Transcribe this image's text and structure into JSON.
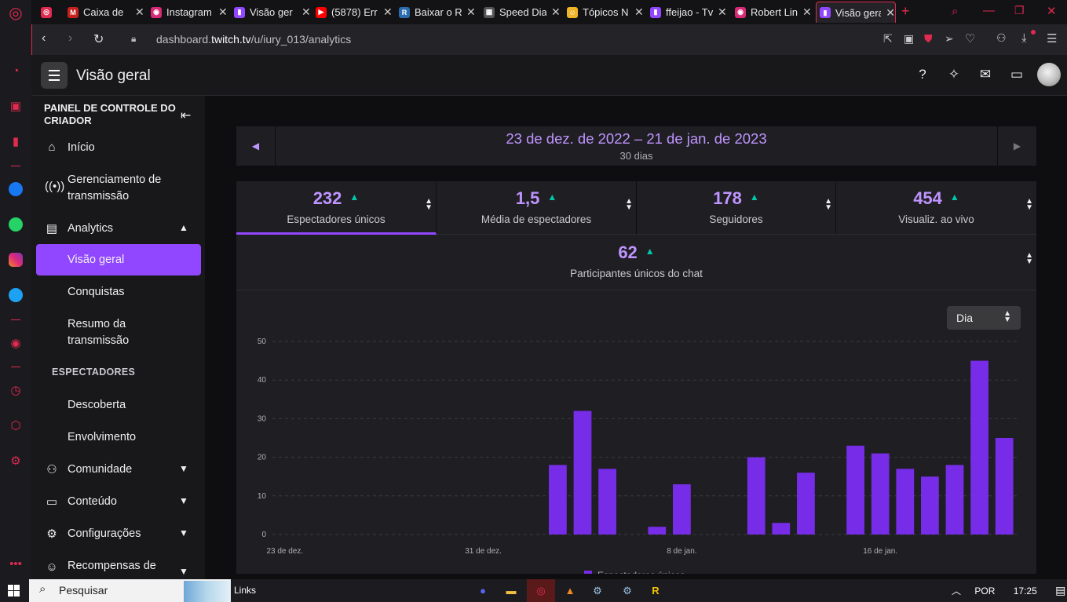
{
  "browser": {
    "tabs": [
      {
        "title": "",
        "fav_color": "#e02a4f",
        "fav_glyph": "◎",
        "x": 12,
        "w": 24
      },
      {
        "title": "Caixa de",
        "fav_color": "#c5221f",
        "fav_glyph": "M",
        "x": 46,
        "w": 100
      },
      {
        "title": "Instagram",
        "fav_color": "#d62976",
        "fav_glyph": "◉",
        "x": 152,
        "w": 100
      },
      {
        "title": "Visão ger",
        "fav_color": "#9147ff",
        "fav_glyph": "▮",
        "x": 258,
        "w": 100
      },
      {
        "title": "(5878) Err",
        "fav_color": "#ff0000",
        "fav_glyph": "▶",
        "x": 362,
        "w": 100
      },
      {
        "title": "Baixar o R",
        "fav_color": "#2b6cb0",
        "fav_glyph": "R",
        "x": 468,
        "w": 100
      },
      {
        "title": "Speed Dia",
        "fav_color": "#555555",
        "fav_glyph": "▦",
        "x": 576,
        "w": 100
      },
      {
        "title": "Tópicos N",
        "fav_color": "#f0b429",
        "fav_glyph": "☺",
        "x": 682,
        "w": 100
      },
      {
        "title": "ffeijao - Tv",
        "fav_color": "#9147ff",
        "fav_glyph": "▮",
        "x": 788,
        "w": 100
      },
      {
        "title": "Robert Lin",
        "fav_color": "#d62976",
        "fav_glyph": "◉",
        "x": 896,
        "w": 100
      },
      {
        "title": "Visão gera",
        "fav_color": "#9147ff",
        "fav_glyph": "▮",
        "x": 999,
        "w": 102,
        "active": true
      }
    ],
    "close_glyph": "✕",
    "new_tab_glyph": "+",
    "url_prefix": "dashboard.",
    "url_domain": "twitch.tv",
    "url_path": "/u/iury_013/analytics"
  },
  "header": {
    "title": "Visão geral"
  },
  "sidebar": {
    "heading": "PAINEL DE CONTROLE DO CRIADOR",
    "items": {
      "inicio": "Início",
      "gerenciamento": "Gerenciamento de transmissão",
      "analytics": "Analytics",
      "visao_geral": "Visão geral",
      "conquistas": "Conquistas",
      "resumo": "Resumo da transmissão",
      "espectadores_hdr": "ESPECTADORES",
      "descoberta": "Descoberta",
      "envolvimento": "Envolvimento",
      "comunidade": "Comunidade",
      "conteudo": "Conteúdo",
      "configuracoes": "Configurações",
      "recompensas": "Recompensas de"
    }
  },
  "date_range": {
    "label": "23 de dez. de 2022 – 21 de jan. de 2023",
    "days": "30 dias"
  },
  "stats": [
    {
      "value": "232",
      "label": "Espectadores únicos",
      "selected": true
    },
    {
      "value": "1,5",
      "label": "Média de espectadores"
    },
    {
      "value": "178",
      "label": "Seguidores"
    },
    {
      "value": "454",
      "label": "Visualiz. ao vivo"
    }
  ],
  "stat_chat": {
    "value": "62",
    "label": "Participantes únicos do chat"
  },
  "period": {
    "value": "Dia"
  },
  "chart_data": {
    "type": "bar",
    "x": [
      "23 de dez.",
      "24 de dez.",
      "25 de dez.",
      "26 de dez.",
      "27 de dez.",
      "28 de dez.",
      "29 de dez.",
      "30 de dez.",
      "31 de dez.",
      "1 de jan.",
      "2 de jan.",
      "3 de jan.",
      "4 de jan.",
      "5 de jan.",
      "6 de jan.",
      "7 de jan.",
      "8 de jan.",
      "9 de jan.",
      "10 de jan.",
      "11 de jan.",
      "12 de jan.",
      "13 de jan.",
      "14 de jan.",
      "15 de jan.",
      "16 de jan.",
      "17 de jan.",
      "18 de jan.",
      "19 de jan.",
      "20 de jan.",
      "21 de jan."
    ],
    "tick_labels": [
      "23 de dez.",
      "31 de dez.",
      "8 de jan.",
      "16 de jan."
    ],
    "tick_indices": [
      0,
      8,
      16,
      24
    ],
    "series": [
      {
        "name": "Espectadores únicos",
        "color": "#772ce8",
        "values": [
          0,
          0,
          0,
          0,
          0,
          0,
          0,
          0,
          0,
          0,
          0,
          18,
          32,
          17,
          0,
          2,
          13,
          0,
          0,
          20,
          3,
          16,
          0,
          23,
          21,
          17,
          15,
          18,
          45,
          25
        ]
      }
    ],
    "yticks": [
      0,
      10,
      20,
      30,
      40,
      50
    ],
    "ylim": [
      0,
      50
    ],
    "grid": true,
    "legend": "bottom"
  },
  "taskbar": {
    "search_placeholder": "Pesquisar",
    "links": "Links",
    "lang": "POR",
    "time": "17:25"
  }
}
